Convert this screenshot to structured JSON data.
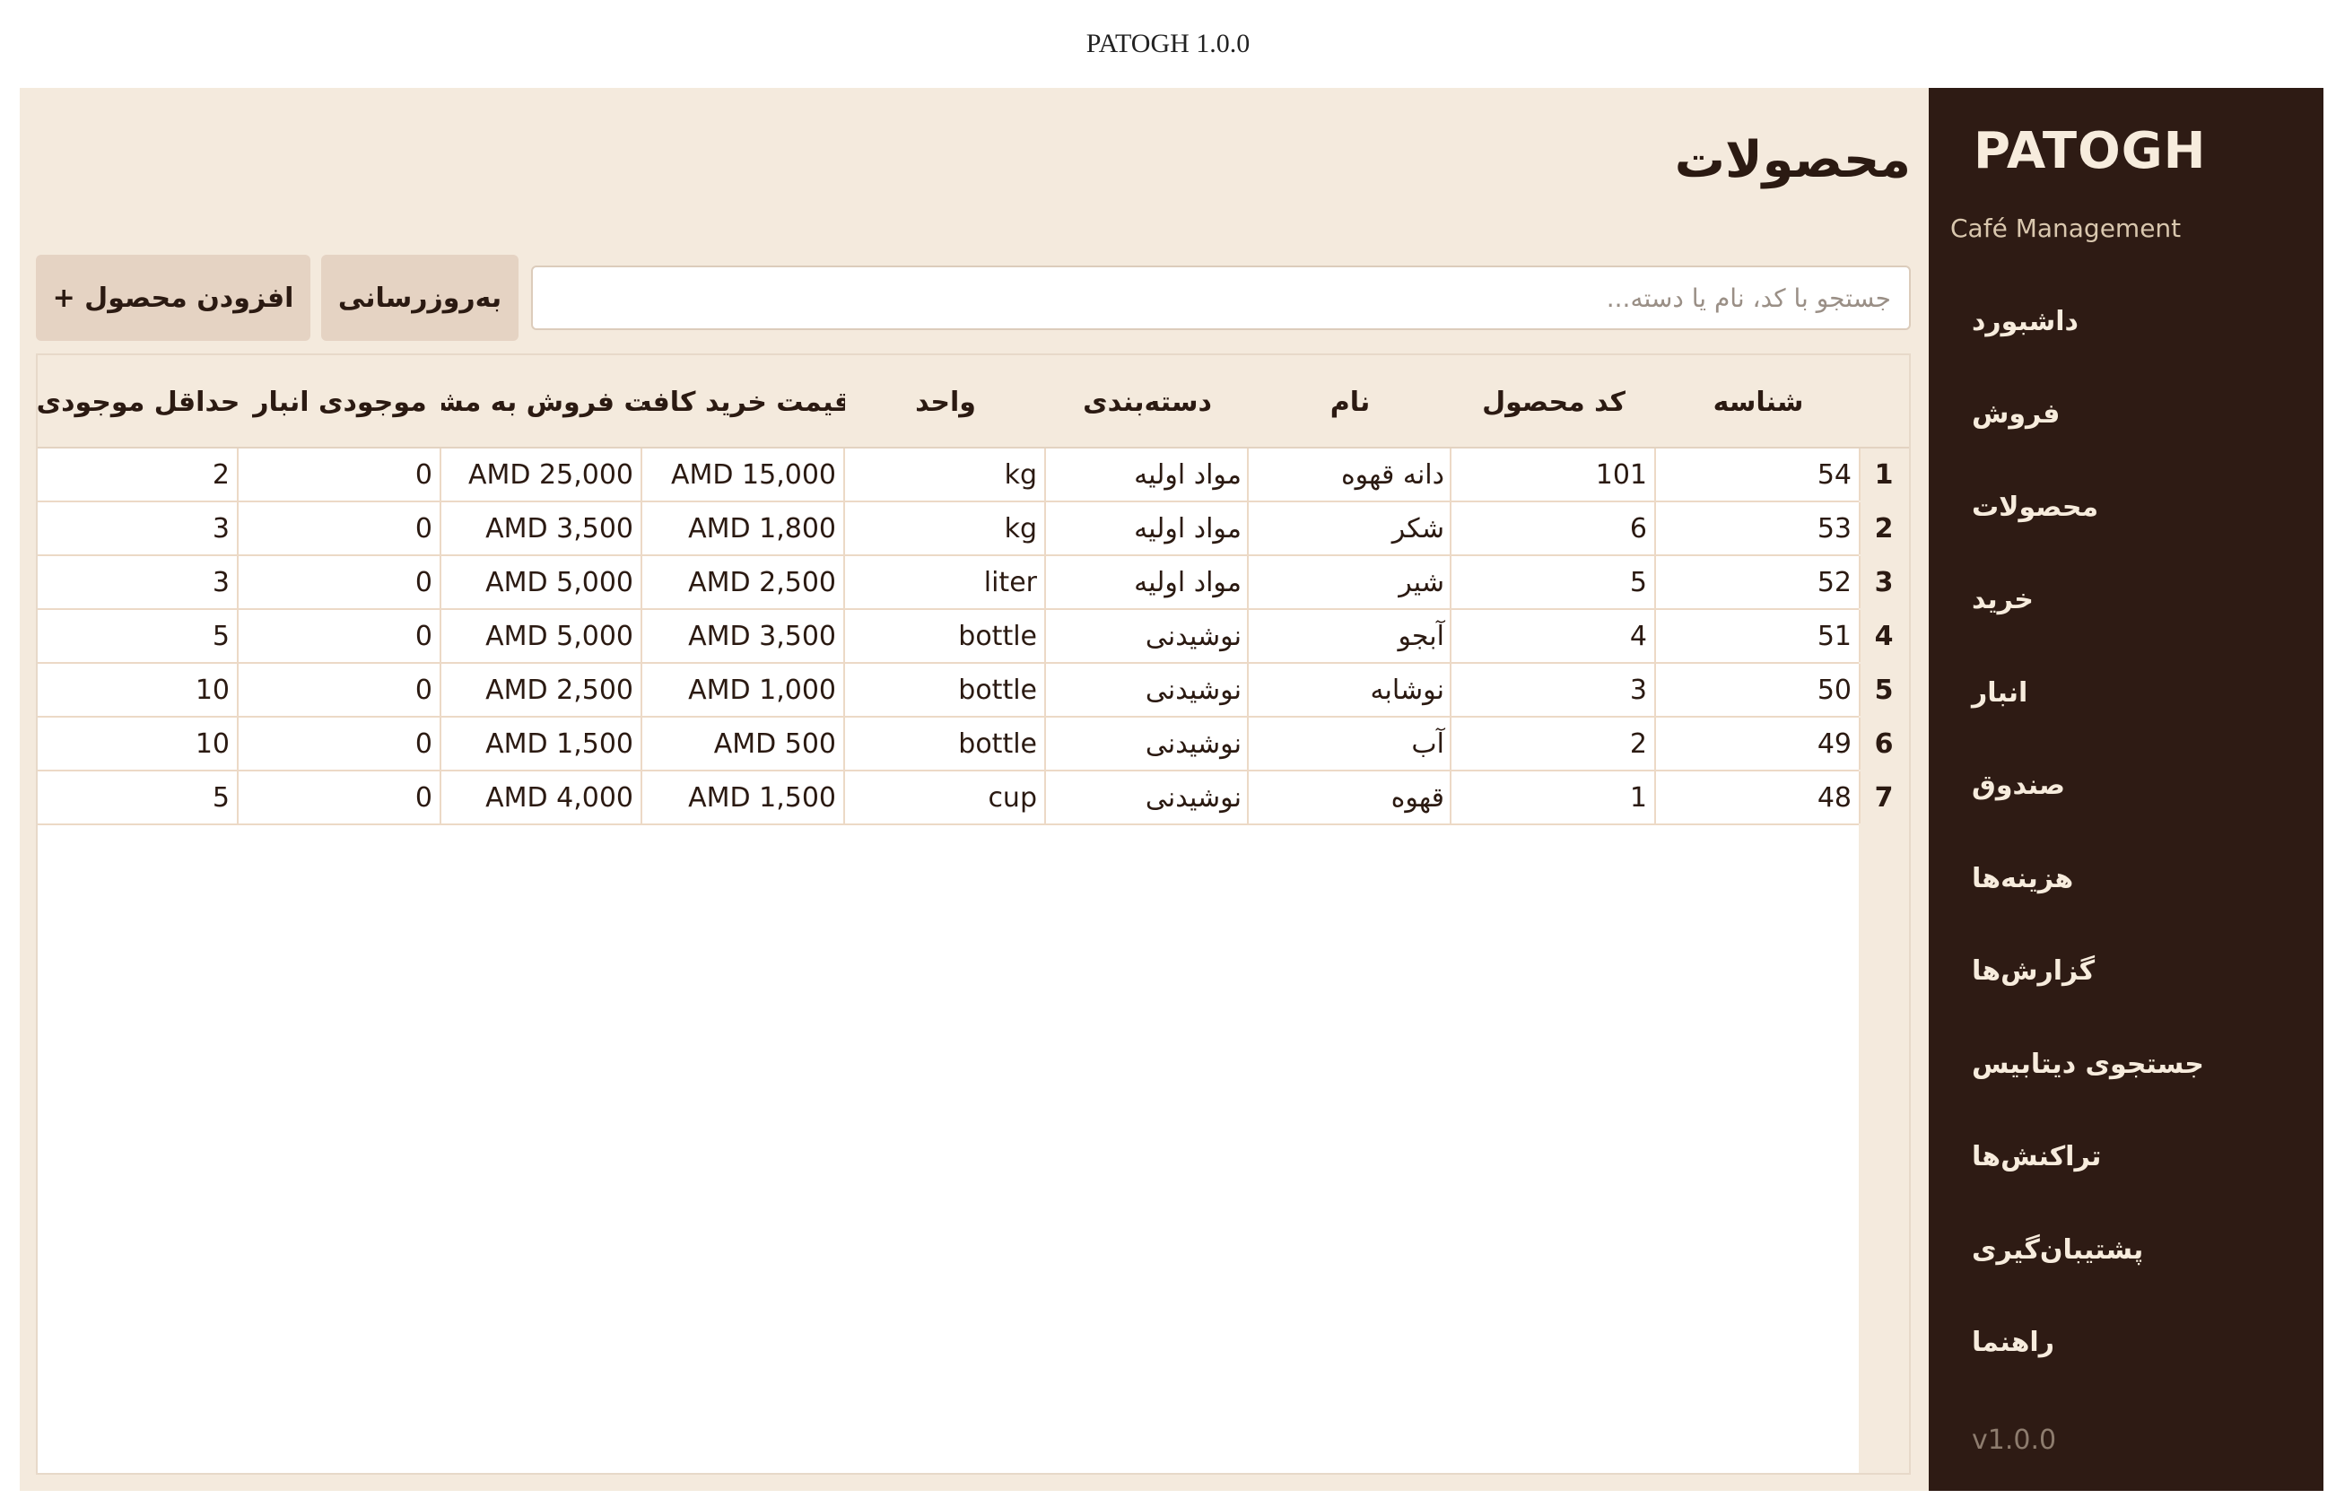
{
  "window": {
    "title": "PATOGH 1.0.0"
  },
  "sidebar": {
    "brand": "PATOGH",
    "subtitle": "Café Management",
    "items": [
      {
        "label": "داشبورد"
      },
      {
        "label": "فروش"
      },
      {
        "label": "محصولات"
      },
      {
        "label": "خرید"
      },
      {
        "label": "انبار"
      },
      {
        "label": "صندوق"
      },
      {
        "label": "هزینه‌ها"
      },
      {
        "label": "گزارش‌ها"
      },
      {
        "label": "جستجوی دیتابیس"
      },
      {
        "label": "تراکنش‌ها"
      },
      {
        "label": "پشتیبان‌گیری"
      },
      {
        "label": "راهنما"
      }
    ],
    "version": "v1.0.0"
  },
  "page": {
    "title": "محصولات"
  },
  "toolbar": {
    "search_placeholder": "جستجو با کد، نام یا دسته...",
    "search_value": "",
    "refresh_label": "به‌روزرسانی",
    "add_label": "افزودن محصول +"
  },
  "table": {
    "headers": {
      "id": "شناسه",
      "code": "کد محصول",
      "name": "نام",
      "category": "دسته‌بندی",
      "unit": "واحد",
      "buy_price": "قیمت خرید کافه",
      "sell_price": "قیمت فروش به مشتری",
      "stock": "موجودی انبار",
      "min_stock": "حداقل موجودی"
    },
    "rows": [
      {
        "num": "1",
        "id": "54",
        "code": "101",
        "name": "دانه قهوه",
        "category": "مواد اولیه",
        "unit": "kg",
        "buy_price": "AMD 15,000",
        "sell_price": "AMD 25,000",
        "stock": "0",
        "min_stock": "2"
      },
      {
        "num": "2",
        "id": "53",
        "code": "6",
        "name": "شکر",
        "category": "مواد اولیه",
        "unit": "kg",
        "buy_price": "AMD 1,800",
        "sell_price": "AMD 3,500",
        "stock": "0",
        "min_stock": "3"
      },
      {
        "num": "3",
        "id": "52",
        "code": "5",
        "name": "شیر",
        "category": "مواد اولیه",
        "unit": "liter",
        "buy_price": "AMD 2,500",
        "sell_price": "AMD 5,000",
        "stock": "0",
        "min_stock": "3"
      },
      {
        "num": "4",
        "id": "51",
        "code": "4",
        "name": "آبجو",
        "category": "نوشیدنی",
        "unit": "bottle",
        "buy_price": "AMD 3,500",
        "sell_price": "AMD 5,000",
        "stock": "0",
        "min_stock": "5"
      },
      {
        "num": "5",
        "id": "50",
        "code": "3",
        "name": "نوشابه",
        "category": "نوشیدنی",
        "unit": "bottle",
        "buy_price": "AMD 1,000",
        "sell_price": "AMD 2,500",
        "stock": "0",
        "min_stock": "10"
      },
      {
        "num": "6",
        "id": "49",
        "code": "2",
        "name": "آب",
        "category": "نوشیدنی",
        "unit": "bottle",
        "buy_price": "AMD 500",
        "sell_price": "AMD 1,500",
        "stock": "0",
        "min_stock": "10"
      },
      {
        "num": "7",
        "id": "48",
        "code": "1",
        "name": "قهوه",
        "category": "نوشیدنی",
        "unit": "cup",
        "buy_price": "AMD 1,500",
        "sell_price": "AMD 4,000",
        "stock": "0",
        "min_stock": "5"
      }
    ]
  },
  "colors": {
    "sidebar_bg": "#2e1b14",
    "content_bg": "#f4eadd",
    "button_bg": "#e5d3c3",
    "text": "#2b1a12"
  }
}
